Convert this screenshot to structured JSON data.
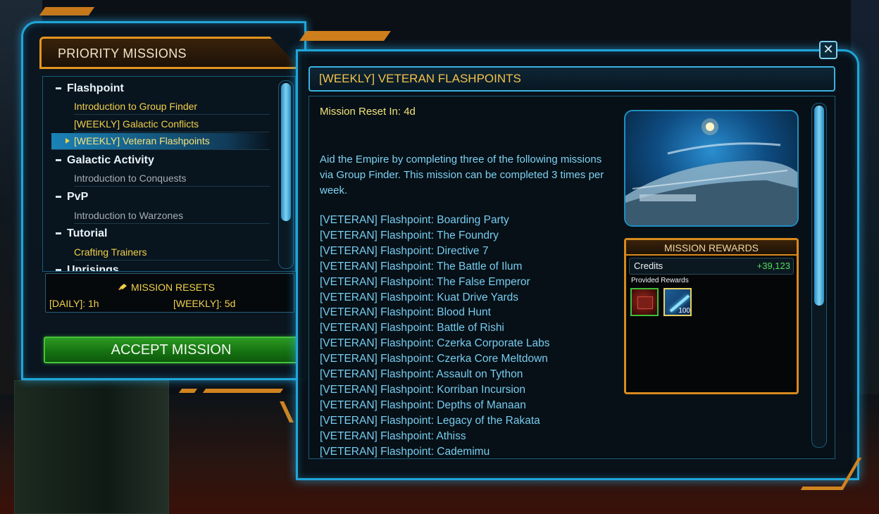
{
  "left_panel": {
    "title": "PRIORITY MISSIONS",
    "categories": [
      {
        "label": "Flashpoint",
        "items": [
          {
            "label": "Introduction to Group Finder",
            "state": "available"
          },
          {
            "label": "[WEEKLY] Galactic Conflicts",
            "state": "available"
          },
          {
            "label": "[WEEKLY] Veteran Flashpoints",
            "state": "selected"
          }
        ]
      },
      {
        "label": "Galactic Activity",
        "items": [
          {
            "label": "Introduction to Conquests",
            "state": "unavailable"
          }
        ]
      },
      {
        "label": "PvP",
        "items": [
          {
            "label": "Introduction to Warzones",
            "state": "unavailable"
          }
        ]
      },
      {
        "label": "Tutorial",
        "items": [
          {
            "label": "Crafting Trainers",
            "state": "available"
          }
        ]
      },
      {
        "label": "Uprisings",
        "items": []
      }
    ],
    "resets": {
      "title": "MISSION RESETS",
      "daily": "[DAILY]: 1h",
      "weekly": "[WEEKLY]: 5d"
    },
    "accept_label": "ACCEPT MISSION"
  },
  "mission": {
    "title": "[WEEKLY] VETERAN FLASHPOINTS",
    "reset_in": "Mission Reset In: 4d",
    "description": "Aid the Empire by completing three of the following missions via Group Finder. This mission can be completed 3 times per week.",
    "flashpoints": [
      "[VETERAN] Flashpoint: Boarding Party",
      "[VETERAN] Flashpoint: The Foundry",
      "[VETERAN] Flashpoint: Directive 7",
      "[VETERAN] Flashpoint: The Battle of Ilum",
      "[VETERAN] Flashpoint: The False Emperor",
      "[VETERAN] Flashpoint: Kuat Drive Yards",
      "[VETERAN] Flashpoint: Blood Hunt",
      "[VETERAN] Flashpoint: Battle of Rishi",
      "[VETERAN] Flashpoint: Czerka Corporate Labs",
      "[VETERAN] Flashpoint: Czerka Core Meltdown",
      "[VETERAN] Flashpoint: Assault on Tython",
      "[VETERAN] Flashpoint: Korriban Incursion",
      "[VETERAN] Flashpoint: Depths of Manaan",
      "[VETERAN] Flashpoint: Legacy of the Rakata",
      "[VETERAN] Flashpoint: Athiss",
      "[VETERAN] Flashpoint: Cademimu"
    ],
    "rewards": {
      "title": "MISSION REWARDS",
      "credits_label": "Credits",
      "credits_value": "+39,123",
      "provided_label": "Provided Rewards",
      "items": [
        {
          "icon": "crate-icon",
          "quantity": ""
        },
        {
          "icon": "xp-boost-icon",
          "quantity": "100"
        }
      ]
    }
  },
  "colors": {
    "frame_blue": "#1fa6d8",
    "accent_orange": "#d88a1e",
    "text_yellow": "#f2d04a",
    "text_cyan": "#78ccf0",
    "credits_green": "#54e05a",
    "accept_green": "#2c9a22"
  },
  "close_icon": "close-icon"
}
